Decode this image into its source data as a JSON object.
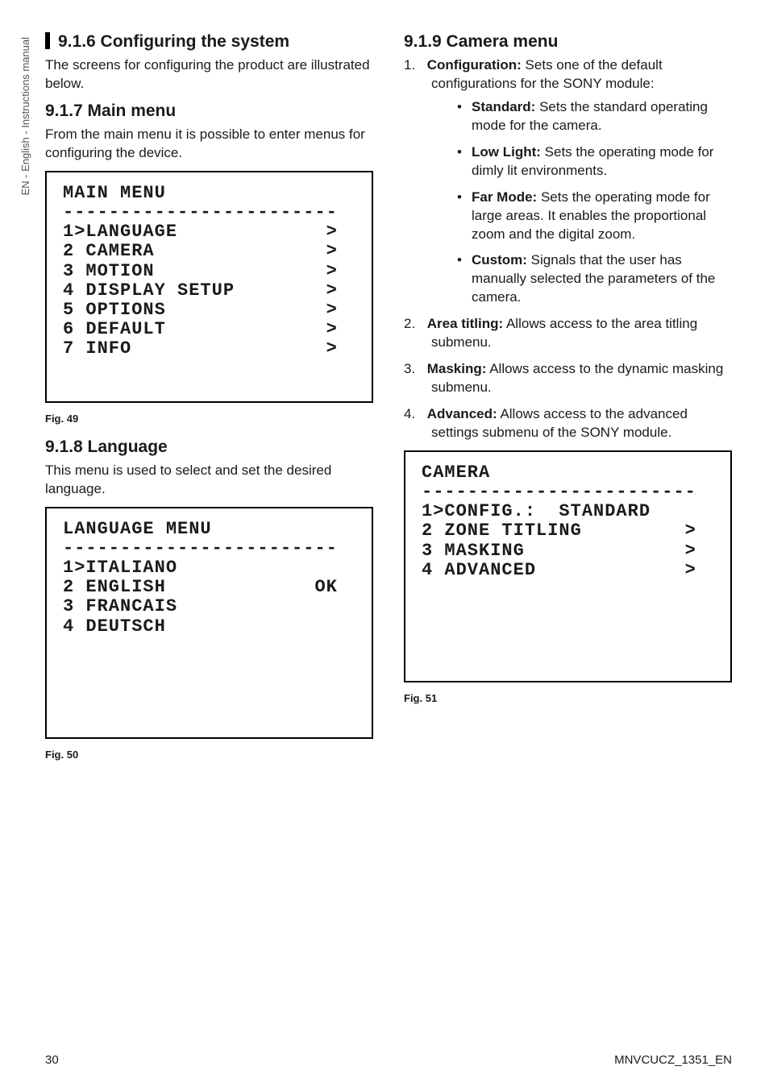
{
  "sidebar_rotated": "EN - English - Instructions manual",
  "left": {
    "s1": {
      "title": "9.1.6 Configuring the system",
      "p1": "The screens for configuring the product are illustrated below."
    },
    "s2": {
      "title": "9.1.7 Main menu",
      "p1": "From the main menu it is possible to enter menus for configuring the device."
    },
    "screen_main_title": "MAIN MENU",
    "screen_main_sep": "------------------------",
    "screen_main": [
      {
        "label": "1>LANGUAGE",
        "r": ">"
      },
      {
        "label": "2 CAMERA",
        "r": ">"
      },
      {
        "label": "3 MOTION",
        "r": ">"
      },
      {
        "label": "4 DISPLAY SETUP",
        "r": ">"
      },
      {
        "label": "5 OPTIONS",
        "r": ">"
      },
      {
        "label": "6 DEFAULT",
        "r": ">"
      },
      {
        "label": "7 INFO",
        "r": ">"
      }
    ],
    "fig49": "Fig. 49",
    "s3": {
      "title": "9.1.8 Language",
      "p1": "This menu is used to select and set the desired language."
    },
    "screen_lang_title": "LANGUAGE MENU",
    "screen_lang_sep": "------------------------",
    "screen_lang": [
      {
        "label": "1>ITALIANO",
        "r": ""
      },
      {
        "label": "2 ENGLISH",
        "r": "OK"
      },
      {
        "label": "3 FRANCAIS",
        "r": ""
      },
      {
        "label": "4 DEUTSCH",
        "r": ""
      }
    ],
    "fig50": "Fig. 50"
  },
  "right": {
    "s4": {
      "title": "9.1.9 Camera menu"
    },
    "item1": {
      "n": "1.",
      "lead": "Configuration:",
      "rest": " Sets one of the default configurations for the SONY module:"
    },
    "bullets": [
      {
        "lead": "Standard:",
        "rest": " Sets the standard operating mode for the camera."
      },
      {
        "lead": "Low Light:",
        "rest": " Sets the operating mode for dimly lit environments."
      },
      {
        "lead": "Far Mode:",
        "rest": " Sets the operating mode for large areas. It enables the proportional zoom and the digital zoom."
      },
      {
        "lead": "Custom:",
        "rest": " Signals that the user has manually selected the parameters of the camera."
      }
    ],
    "item2": {
      "n": "2.",
      "lead": "Area titling:",
      "rest": " Allows access to the area titling submenu."
    },
    "item3": {
      "n": "3.",
      "lead": "Masking:",
      "rest": " Allows access to the dynamic masking submenu."
    },
    "item4": {
      "n": "4.",
      "lead": "Advanced:",
      "rest": " Allows access to the advanced settings submenu of the SONY module."
    },
    "screen_cam_title": "CAMERA",
    "screen_cam_sep": "------------------------",
    "screen_cam": [
      {
        "label": "1>CONFIG.:  STANDARD",
        "r": ""
      },
      {
        "label": "2 ZONE TITLING",
        "r": ">"
      },
      {
        "label": "3 MASKING",
        "r": ">"
      },
      {
        "label": "4 ADVANCED",
        "r": ">"
      }
    ],
    "fig51": "Fig. 51"
  },
  "footer": {
    "page": "30",
    "doc": "MNVCUCZ_1351_EN"
  }
}
